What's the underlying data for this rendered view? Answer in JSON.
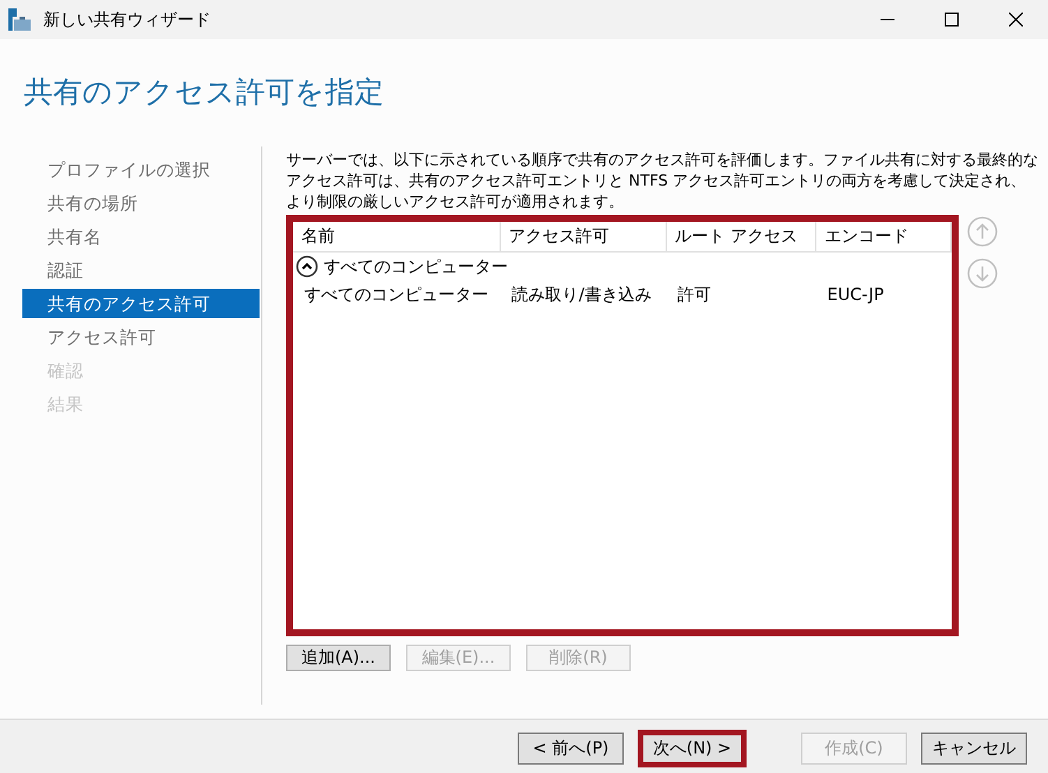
{
  "window": {
    "title": "新しい共有ウィザード"
  },
  "heading": "共有のアクセス許可を指定",
  "nav": [
    {
      "label": "プロファイルの選択",
      "selected": false,
      "disabled": false
    },
    {
      "label": "共有の場所",
      "selected": false,
      "disabled": false
    },
    {
      "label": "共有名",
      "selected": false,
      "disabled": false
    },
    {
      "label": "認証",
      "selected": false,
      "disabled": false
    },
    {
      "label": "共有のアクセス許可",
      "selected": true,
      "disabled": false
    },
    {
      "label": "アクセス許可",
      "selected": false,
      "disabled": false
    },
    {
      "label": "確認",
      "selected": false,
      "disabled": true
    },
    {
      "label": "結果",
      "selected": false,
      "disabled": true
    }
  ],
  "description": "サーバーでは、以下に示されている順序で共有のアクセス許可を評価します。ファイル共有に対する最終的なアクセス許可は、共有のアクセス許可エントリと NTFS アクセス許可エントリの両方を考慮して決定され、より制限の厳しいアクセス許可が適用されます。",
  "table": {
    "highlighted": true,
    "columns": [
      "名前",
      "アクセス許可",
      "ルート アクセス",
      "エンコード"
    ],
    "groups": [
      {
        "label": "すべてのコンピューター",
        "expanded": true,
        "rows": [
          [
            "すべてのコンピューター",
            "読み取り/書き込み",
            "許可",
            "EUC-JP"
          ]
        ]
      }
    ]
  },
  "list_buttons": [
    {
      "label": "追加(A)...",
      "disabled": false
    },
    {
      "label": "編集(E)...",
      "disabled": true
    },
    {
      "label": "削除(R)",
      "disabled": true
    }
  ],
  "footer_buttons": [
    {
      "label": "< 前へ(P)",
      "disabled": false,
      "highlighted": false
    },
    {
      "label": "次へ(N) >",
      "disabled": false,
      "highlighted": true
    },
    {
      "label": "作成(C)",
      "disabled": true,
      "highlighted": false
    },
    {
      "label": "キャンセル",
      "disabled": false,
      "highlighted": false
    }
  ]
}
